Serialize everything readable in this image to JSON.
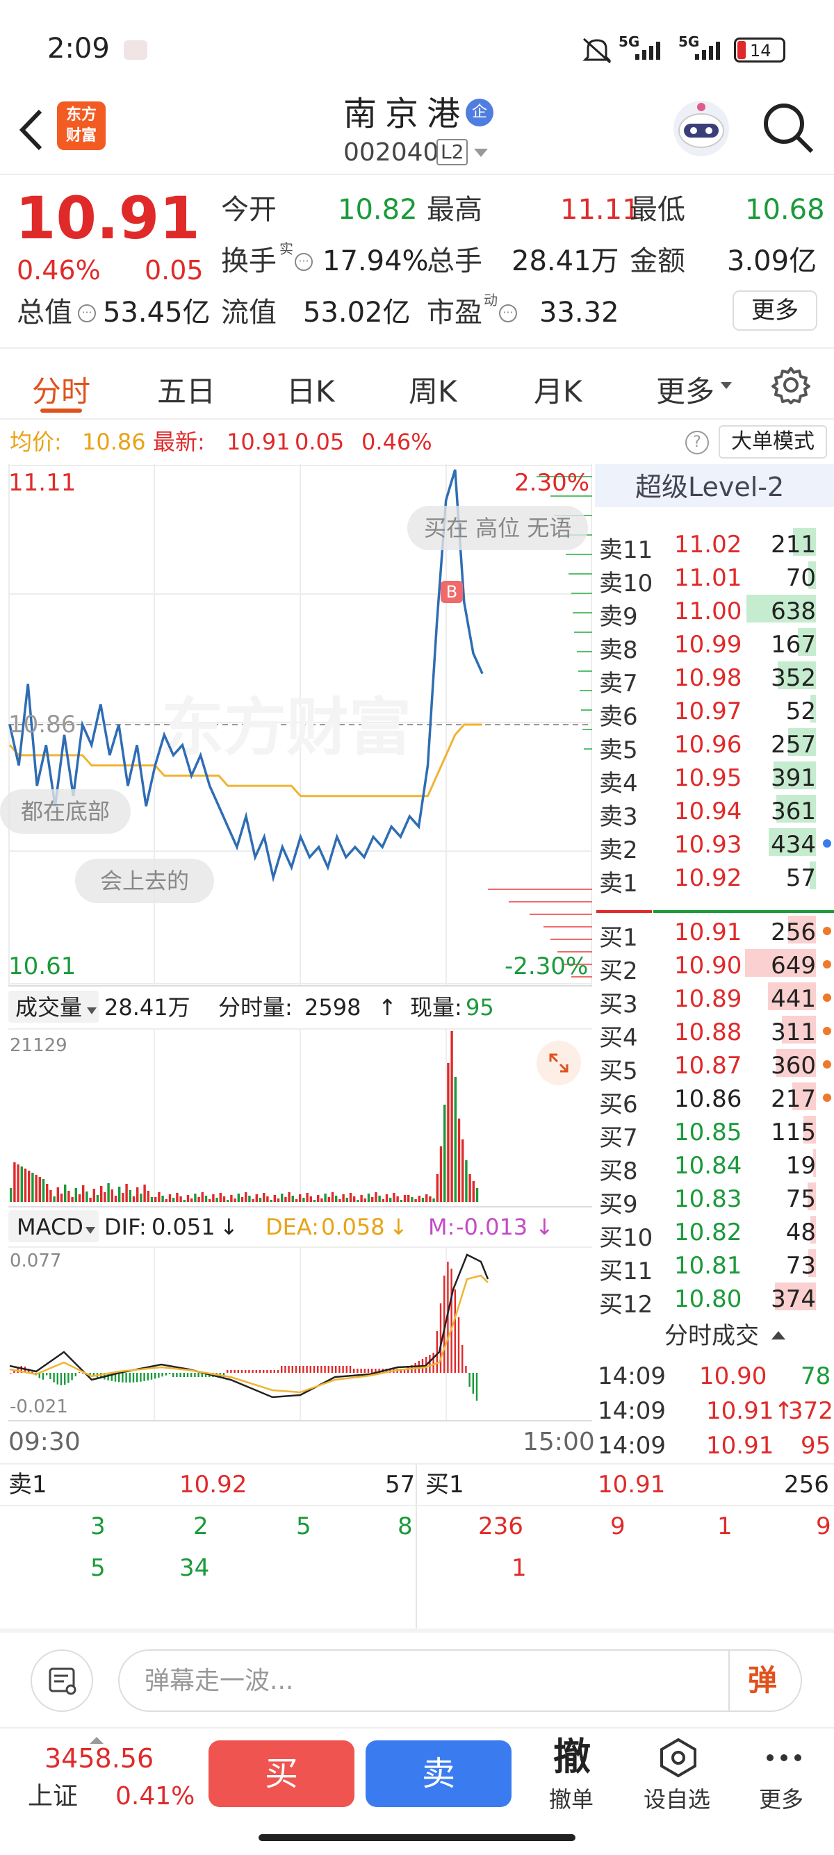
{
  "status_bar": {
    "time": "2:09",
    "signal1": "5G",
    "signal2": "5G",
    "battery": "14"
  },
  "header": {
    "title": "南京港",
    "badge": "企",
    "code": "002040",
    "level": "L2",
    "logo_line1": "东方",
    "logo_line2": "财富"
  },
  "quote": {
    "price": "10.91",
    "change_pct": "0.46%",
    "change": "0.05",
    "open_label": "今开",
    "open": "10.82",
    "high_label": "最高",
    "high": "11.11",
    "low_label": "最低",
    "low": "10.68",
    "turnover_label": "换手",
    "turnover_sup": "实",
    "turnover": "17.94%",
    "volume_label": "总手",
    "volume": "28.41万",
    "amount_label": "金额",
    "amount": "3.09亿",
    "mktcap_label": "总值",
    "mktcap": "53.45亿",
    "float_label": "流值",
    "float": "53.02亿",
    "pe_label": "市盈",
    "pe_sup": "动",
    "pe": "33.32",
    "more": "更多"
  },
  "tabs": [
    "分时",
    "五日",
    "日K",
    "周K",
    "月K",
    "更多"
  ],
  "chart_header": {
    "avg_label": "均价:",
    "avg": "10.86",
    "latest_label": "最新:",
    "latest": "10.91",
    "chg": "0.05",
    "chg_pct": "0.46%",
    "mode_button": "大单模式"
  },
  "chart_data": {
    "type": "line",
    "title": "",
    "ylim": [
      10.61,
      11.11
    ],
    "y_top_label": "11.11",
    "y_mid_label": "10.86",
    "y_bottom_label": "10.61",
    "pct_top": "2.30%",
    "pct_bottom": "-2.30%",
    "x_start": "09:30",
    "x_end": "15:00",
    "series": [
      {
        "values": [
          10.86,
          10.82,
          10.9,
          10.8,
          10.84,
          10.78,
          10.85,
          10.79,
          10.86,
          10.84,
          10.88,
          10.83,
          10.86,
          10.8,
          10.84,
          10.78,
          10.82,
          10.85,
          10.83,
          10.84,
          10.81,
          10.83,
          10.8,
          10.78,
          10.76,
          10.74,
          10.77,
          10.73,
          10.75,
          10.71,
          10.74,
          10.72,
          10.75,
          10.73,
          10.74,
          10.72,
          10.75,
          10.73,
          10.74,
          10.73,
          10.75,
          10.74,
          10.76,
          10.75,
          10.77,
          10.76,
          10.82,
          10.96,
          11.08,
          11.11,
          10.98,
          10.93,
          10.91
        ]
      },
      {
        "values": [
          10.84,
          10.83,
          10.83,
          10.83,
          10.83,
          10.83,
          10.83,
          10.83,
          10.83,
          10.82,
          10.82,
          10.82,
          10.82,
          10.82,
          10.82,
          10.82,
          10.82,
          10.81,
          10.81,
          10.81,
          10.81,
          10.81,
          10.81,
          10.81,
          10.8,
          10.8,
          10.8,
          10.8,
          10.8,
          10.8,
          10.8,
          10.8,
          10.79,
          10.79,
          10.79,
          10.79,
          10.79,
          10.79,
          10.79,
          10.79,
          10.79,
          10.79,
          10.79,
          10.79,
          10.79,
          10.79,
          10.79,
          10.81,
          10.83,
          10.85,
          10.86,
          10.86,
          10.86
        ]
      }
    ]
  },
  "chart_labels": {
    "super_level": "超级Level-2",
    "bubble1": "买在 高位 无语",
    "bubble2": "都在底部",
    "bubble3": "会上去的",
    "watermark": "东方财富",
    "b_marker": "B"
  },
  "volume_panel": {
    "label": "成交量",
    "total": "28.41万",
    "minute_label": "分时量:",
    "minute": "2598",
    "now_label": "现量:",
    "now": "95",
    "max": "21129"
  },
  "macd": {
    "label": "MACD",
    "dif_label": "DIF:",
    "dif": "0.051",
    "dea_label": "DEA:",
    "dea": "0.058",
    "m_label": "M:",
    "m": "-0.013",
    "top": "0.077",
    "bottom": "-0.021"
  },
  "order_book": {
    "sell": [
      {
        "label": "卖11",
        "price": "11.02",
        "vol": "211"
      },
      {
        "label": "卖10",
        "price": "11.01",
        "vol": "70"
      },
      {
        "label": "卖9",
        "price": "11.00",
        "vol": "638"
      },
      {
        "label": "卖8",
        "price": "10.99",
        "vol": "167"
      },
      {
        "label": "卖7",
        "price": "10.98",
        "vol": "352"
      },
      {
        "label": "卖6",
        "price": "10.97",
        "vol": "52"
      },
      {
        "label": "卖5",
        "price": "10.96",
        "vol": "257"
      },
      {
        "label": "卖4",
        "price": "10.95",
        "vol": "391"
      },
      {
        "label": "卖3",
        "price": "10.94",
        "vol": "361"
      },
      {
        "label": "卖2",
        "price": "10.93",
        "vol": "434"
      },
      {
        "label": "卖1",
        "price": "10.92",
        "vol": "57"
      }
    ],
    "buy": [
      {
        "label": "买1",
        "price": "10.91",
        "vol": "256"
      },
      {
        "label": "买2",
        "price": "10.90",
        "vol": "649"
      },
      {
        "label": "买3",
        "price": "10.89",
        "vol": "441"
      },
      {
        "label": "买4",
        "price": "10.88",
        "vol": "311"
      },
      {
        "label": "买5",
        "price": "10.87",
        "vol": "360"
      },
      {
        "label": "买6",
        "price": "10.86",
        "vol": "217"
      },
      {
        "label": "买7",
        "price": "10.85",
        "vol": "115"
      },
      {
        "label": "买8",
        "price": "10.84",
        "vol": "19"
      },
      {
        "label": "买9",
        "price": "10.83",
        "vol": "75"
      },
      {
        "label": "买10",
        "price": "10.82",
        "vol": "48"
      },
      {
        "label": "买11",
        "price": "10.81",
        "vol": "73"
      },
      {
        "label": "买12",
        "price": "10.80",
        "vol": "374"
      }
    ]
  },
  "trades": {
    "title": "分时成交",
    "rows": [
      {
        "time": "14:09",
        "price": "10.90",
        "vol": "78"
      },
      {
        "time": "14:09",
        "price": "10.91↑",
        "vol": "372"
      },
      {
        "time": "14:09",
        "price": "10.91",
        "vol": "95"
      }
    ]
  },
  "queue": {
    "sell_label": "卖1",
    "sell_price": "10.92",
    "sell_total": "57",
    "buy_label": "买1",
    "buy_price": "10.91",
    "buy_total": "256",
    "sell_items": [
      "3",
      "2",
      "5",
      "8",
      "5",
      "34"
    ],
    "buy_items": [
      "236",
      "9",
      "1",
      "9",
      "1"
    ]
  },
  "comment": {
    "placeholder": "弹幕走一波...",
    "danmu": "弹"
  },
  "bottom_bar": {
    "index_value": "3458.56",
    "index_name": "上证",
    "index_pct": "0.41%",
    "buy": "买",
    "sell": "卖",
    "cancel_icon": "撤",
    "cancel": "撤单",
    "watch": "设自选",
    "more": "更多"
  }
}
